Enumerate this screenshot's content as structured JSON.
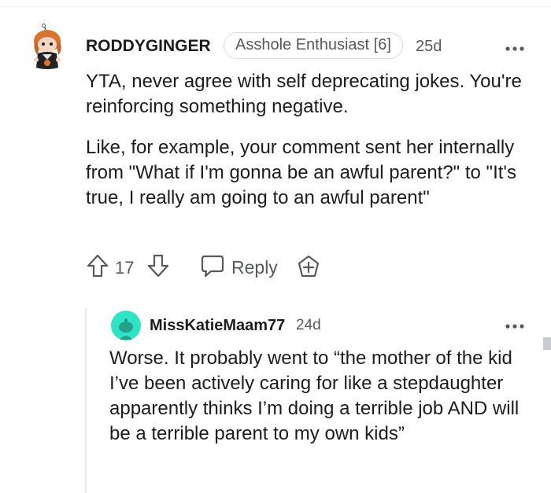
{
  "parent_comment": {
    "username": "RODDYGINGER",
    "flair": "Asshole Enthusiast [6]",
    "timestamp": "25d",
    "paragraphs": [
      "YTA, never agree with self deprecating jokes. You're reinforcing something negative.",
      "Like, for example, your comment sent her internally from \"What if I'm gonna be an awful parent?\" to \"It's true, I really am going to an awful parent\""
    ],
    "score": "17",
    "reply_label": "Reply",
    "icons": {
      "avatar": "user-avatar-icon",
      "more": "more-options-icon",
      "upvote": "upvote-arrow-icon",
      "downvote": "downvote-arrow-icon",
      "reply": "speech-bubble-icon",
      "award": "award-plus-icon"
    }
  },
  "child_comment": {
    "username": "MissKatieMaam77",
    "timestamp": "24d",
    "text": "Worse. It probably went to “the mother of the kid I’ve been actively caring for like a stepdaughter apparently thinks I’m doing a terrible job AND will be a terrible parent to my own kids”",
    "icons": {
      "avatar": "snoo-avatar-icon",
      "more": "more-options-icon"
    }
  },
  "colors": {
    "text": "#1c1c1c",
    "meta": "#57595b",
    "child_avatar": "#2fe3c5",
    "divider": "#edeff1"
  }
}
